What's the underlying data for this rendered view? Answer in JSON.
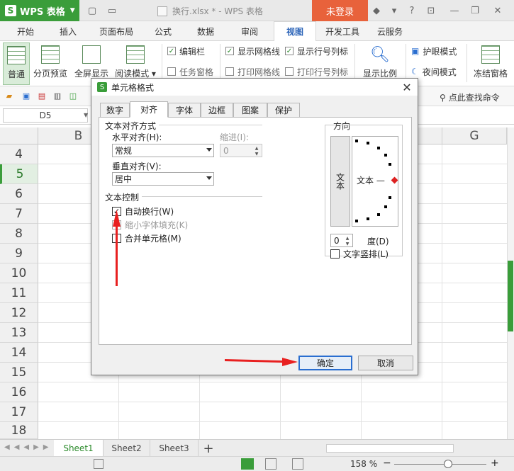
{
  "app": {
    "name": "WPS 表格",
    "login_label": "未登录"
  },
  "document": {
    "title": "换行.xlsx * - WPS 表格"
  },
  "menu_tabs": [
    "开始",
    "插入",
    "页面布局",
    "公式",
    "数据",
    "审阅",
    "视图",
    "开发工具",
    "云服务"
  ],
  "active_menu_tab": "视图",
  "ribbon": {
    "normal_label": "普通",
    "page_break_label": "分页预览",
    "fullscreen_label": "全屏显示",
    "reading_mode_label": "阅读模式",
    "checks": [
      {
        "label": "编辑栏",
        "checked": true
      },
      {
        "label": "任务窗格",
        "checked": false
      },
      {
        "label": "显示网格线",
        "checked": true
      },
      {
        "label": "打印网格线",
        "checked": false
      },
      {
        "label": "显示行号列标",
        "checked": true
      },
      {
        "label": "打印行号列标",
        "checked": false
      }
    ],
    "zoom_label": "显示比例",
    "eye_mode_label": "护眼模式",
    "night_mode_label": "夜间模式",
    "freeze_label": "冻结窗格"
  },
  "quickbar": {
    "find_command": "点此查找命令"
  },
  "formula_bar": {
    "name_box": "D5"
  },
  "grid": {
    "columns": [
      "B",
      "G"
    ],
    "rows": [
      "4",
      "5",
      "6",
      "7",
      "8",
      "9",
      "10",
      "11",
      "12",
      "13",
      "14",
      "15",
      "16",
      "17",
      "18"
    ],
    "selected_row": "5"
  },
  "sheets": [
    "Sheet1",
    "Sheet2",
    "Sheet3"
  ],
  "active_sheet": "Sheet1",
  "status": {
    "zoom": "158 %"
  },
  "dialog": {
    "title": "单元格格式",
    "tabs": [
      "数字",
      "对齐",
      "字体",
      "边框",
      "图案",
      "保护"
    ],
    "active_tab": "对齐",
    "text_alignment_group": "文本对齐方式",
    "horizontal_label": "水平对齐(H):",
    "horizontal_value": "常规",
    "indent_label": "缩进(I):",
    "indent_value": "0",
    "vertical_label": "垂直对齐(V):",
    "vertical_value": "居中",
    "text_control_group": "文本控制",
    "wrap_text_label": "自动换行(W)",
    "wrap_text_checked": true,
    "shrink_label": "缩小字体填充(K)",
    "merge_label": "合并单元格(M)",
    "orientation_group": "方向",
    "vertical_text": "文本",
    "dial_text": "文本 —",
    "degree_value": "0",
    "degree_label": "度(D)",
    "vertical_layout_label": "文字竖排(L)",
    "ok_label": "确定",
    "cancel_label": "取消"
  },
  "colors": {
    "accent": "#3a9d3a",
    "arrow": "#e82020",
    "login": "#e8623b",
    "dialog_default_border": "#2a6ed0"
  }
}
